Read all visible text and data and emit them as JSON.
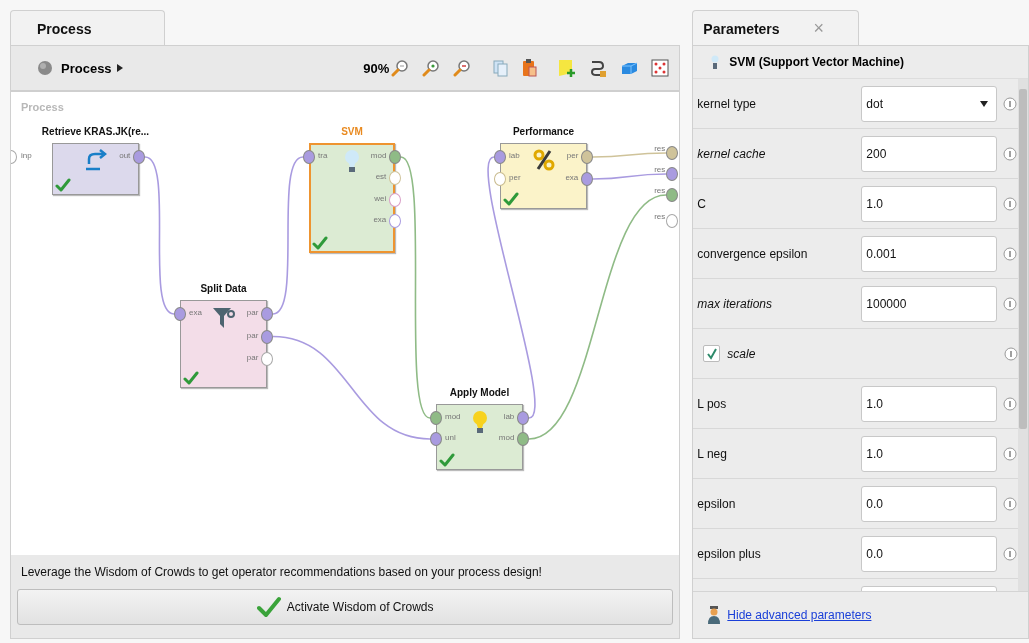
{
  "process_tab": {
    "label": "Process"
  },
  "toolbar": {
    "breadcrumb": "Process",
    "zoom": "90%"
  },
  "canvas": {
    "label": "Process",
    "input_ports": [
      {
        "label": "inp",
        "connected": false,
        "color": "#a8a8a8"
      }
    ],
    "operators": [
      {
        "name": "Retrieve KRAS.JK(re...",
        "kind": "retrieve",
        "selected": false,
        "ok": true,
        "color": "#dcd9ec",
        "outputs": [
          {
            "label": "out",
            "connected": true,
            "color": "#a99be0"
          }
        ]
      },
      {
        "name": "SVM",
        "kind": "learner",
        "selected": true,
        "ok": true,
        "color": "#dcebd3",
        "inputs": [
          {
            "label": "tra",
            "connected": true,
            "color": "#a99be0"
          }
        ],
        "outputs": [
          {
            "label": "mod",
            "connected": true,
            "color": "#8fbb86"
          },
          {
            "label": "est",
            "connected": false,
            "color": "#cfc39a"
          },
          {
            "label": "wei",
            "connected": false,
            "color": "#d9a0c8"
          },
          {
            "label": "exa",
            "connected": false,
            "color": "#a99be0"
          }
        ]
      },
      {
        "name": "Performance",
        "kind": "performance",
        "selected": false,
        "ok": true,
        "color": "#fbf3c9",
        "inputs": [
          {
            "label": "lab",
            "connected": true,
            "color": "#a99be0"
          },
          {
            "label": "per",
            "connected": false,
            "color": "#c9bb8e"
          }
        ],
        "outputs": [
          {
            "label": "per",
            "connected": true,
            "color": "#cfc39a"
          },
          {
            "label": "exa",
            "connected": true,
            "color": "#a99be0"
          }
        ]
      },
      {
        "name": "Split Data",
        "kind": "split",
        "selected": false,
        "ok": true,
        "color": "#f3dde8",
        "inputs": [
          {
            "label": "exa",
            "connected": true,
            "color": "#a99be0"
          }
        ],
        "outputs": [
          {
            "label": "par",
            "connected": true,
            "color": "#a99be0"
          },
          {
            "label": "par",
            "connected": true,
            "color": "#a99be0"
          },
          {
            "label": "par",
            "connected": false,
            "color": "#a8a8a8"
          }
        ]
      },
      {
        "name": "Apply Model",
        "kind": "apply",
        "selected": false,
        "ok": true,
        "color": "#dcebd3",
        "inputs": [
          {
            "label": "mod",
            "connected": true,
            "color": "#8fbb86"
          },
          {
            "label": "unl",
            "connected": true,
            "color": "#a99be0"
          }
        ],
        "outputs": [
          {
            "label": "lab",
            "connected": true,
            "color": "#a99be0"
          },
          {
            "label": "mod",
            "connected": true,
            "color": "#8fbb86"
          }
        ]
      }
    ],
    "result_ports": [
      {
        "label": "res",
        "connected": true,
        "color": "#cfc39a"
      },
      {
        "label": "res",
        "connected": true,
        "color": "#a99be0"
      },
      {
        "label": "res",
        "connected": true,
        "color": "#8fbb86"
      },
      {
        "label": "res",
        "connected": false,
        "color": "#a8a8a8"
      }
    ]
  },
  "recommendation": {
    "message": "Leverage the Wisdom of Crowds to get operator recommendations based on your process design!",
    "button": "Activate Wisdom of Crowds"
  },
  "parameters_tab": {
    "label": "Parameters",
    "close": "×"
  },
  "operator_header": "SVM (Support Vector Machine)",
  "parameters": [
    {
      "kind": "dropdown",
      "label": "kernel type",
      "value": "dot",
      "expert": false
    },
    {
      "kind": "text",
      "label": "kernel cache",
      "value": "200",
      "expert": true
    },
    {
      "kind": "text",
      "label": "C",
      "value": "1.0",
      "expert": false
    },
    {
      "kind": "text",
      "label": "convergence epsilon",
      "value": "0.001",
      "expert": false
    },
    {
      "kind": "text",
      "label": "max iterations",
      "value": "100000",
      "expert": true
    },
    {
      "kind": "checkbox",
      "label": "scale",
      "checked": true,
      "expert": true
    },
    {
      "kind": "text",
      "label": "L pos",
      "value": "1.0",
      "expert": false
    },
    {
      "kind": "text",
      "label": "L neg",
      "value": "1.0",
      "expert": false
    },
    {
      "kind": "text",
      "label": "epsilon",
      "value": "0.0",
      "expert": false
    },
    {
      "kind": "text",
      "label": "epsilon plus",
      "value": "0.0",
      "expert": false
    },
    {
      "kind": "text"
    }
  ],
  "advanced_link": "Hide advanced parameters"
}
